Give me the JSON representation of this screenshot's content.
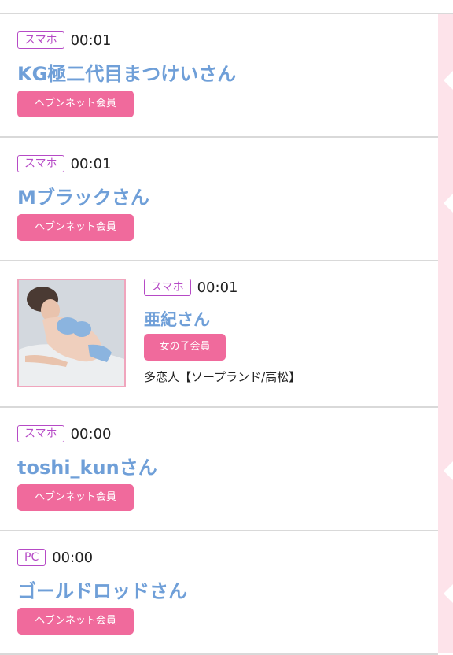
{
  "entries": [
    {
      "device": "スマホ",
      "time": "00:01",
      "name": "KG極二代目まつけいさん",
      "membership": "ヘブンネット会員"
    },
    {
      "device": "スマホ",
      "time": "00:01",
      "name": "Mブラックさん",
      "membership": "ヘブンネット会員"
    },
    {
      "device": "スマホ",
      "time": "00:01",
      "name": "亜紀さん",
      "membership": "女の子会員",
      "shop": "多恋人【ソープランド/高松】",
      "photo": "girl-photo"
    },
    {
      "device": "スマホ",
      "time": "00:00",
      "name": "toshi_kunさん",
      "membership": "ヘブンネット会員"
    },
    {
      "device": "PC",
      "time": "00:00",
      "name": "ゴールドロッドさん",
      "membership": "ヘブンネット会員"
    }
  ],
  "colors": {
    "badge": "#b64ac6",
    "name": "#6f9fd8",
    "member_button": "#f06a9c",
    "side_strip": "#fde3ea"
  }
}
